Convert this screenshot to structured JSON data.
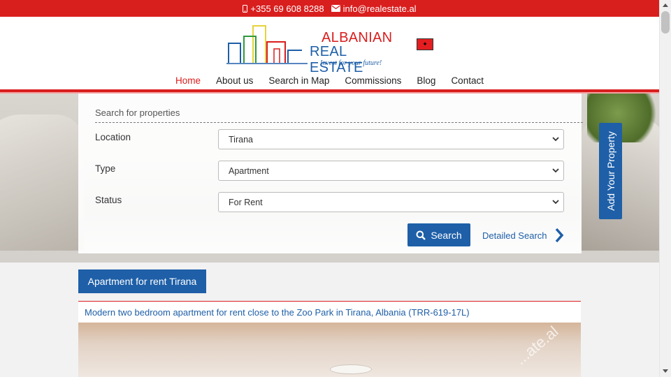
{
  "topbar": {
    "phone": "+355 69 608 8288",
    "email": "info@realestate.al",
    "phone_icon": "mobile-phone-icon",
    "email_icon": "envelope-icon"
  },
  "logo": {
    "line1": "ALBANIAN",
    "line2": "REAL ESTATE",
    "tagline": "Invest for your future!"
  },
  "language_flag": "albanian-flag-icon",
  "nav": [
    {
      "label": "Home",
      "active": true
    },
    {
      "label": "About us"
    },
    {
      "label": "Search in Map"
    },
    {
      "label": "Commissions"
    },
    {
      "label": "Blog"
    },
    {
      "label": "Contact"
    }
  ],
  "search": {
    "title": "Search for properties",
    "fields": [
      {
        "label": "Location",
        "value": "Tirana"
      },
      {
        "label": "Type",
        "value": "Apartment"
      },
      {
        "label": "Status",
        "value": "For Rent"
      }
    ],
    "search_button": "Search",
    "detailed_link": "Detailed Search"
  },
  "add_property": "Add Your Property",
  "category_button": "Apartment for rent Tirana",
  "listing": {
    "title": "Modern two bedroom apartment for rent close to the Zoo Park in Tirana, Albania (TRR-619-17L)",
    "watermark": "...ate.al"
  },
  "colors": {
    "brand_red": "#d91e1e",
    "brand_blue": "#1e5fa8"
  }
}
